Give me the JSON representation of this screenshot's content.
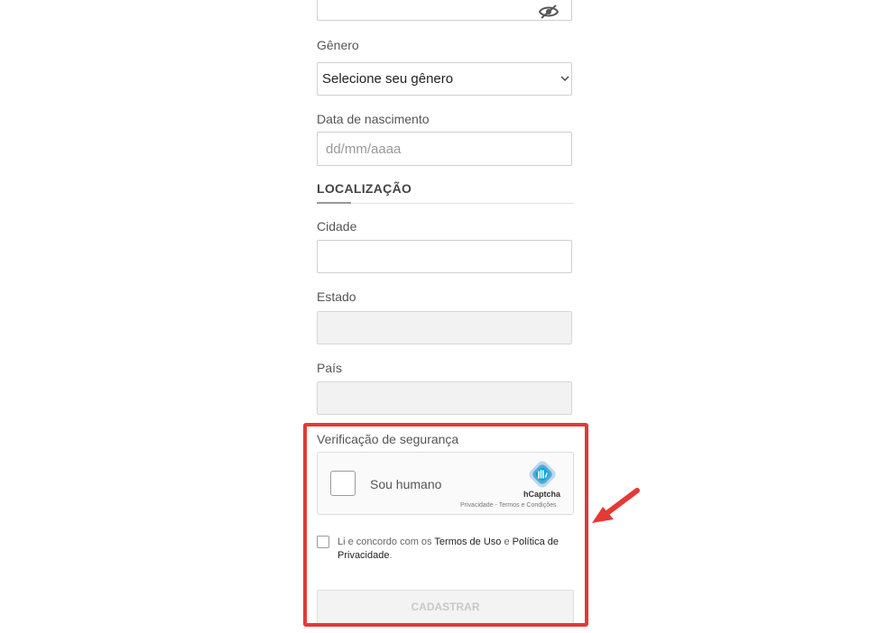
{
  "form": {
    "genero": {
      "label": "Gênero",
      "selected": "Selecione seu gênero"
    },
    "nascimento": {
      "label": "Data de nascimento",
      "placeholder": "dd/mm/aaaa"
    },
    "localizacao": {
      "title": "LOCALIZAÇÃO"
    },
    "cidade": {
      "label": "Cidade"
    },
    "estado": {
      "label": "Estado"
    },
    "pais": {
      "label": "País"
    },
    "seguranca": {
      "label": "Verificação de segurança"
    },
    "captcha": {
      "checkbox_label": "Sou humano",
      "brand": "hCaptcha",
      "privacy": "Privacidade",
      "separator": " - ",
      "terms": "Termos e Condições"
    },
    "terms": {
      "prefix": "Li e concordo com os ",
      "terms_link": "Termos de Uso",
      "conj": " e ",
      "policy_link": "Política de Privacidade",
      "suffix": "."
    },
    "submit_label": "CADASTRAR"
  },
  "colors": {
    "highlight": "#e53935",
    "accent_line": "#999999"
  }
}
